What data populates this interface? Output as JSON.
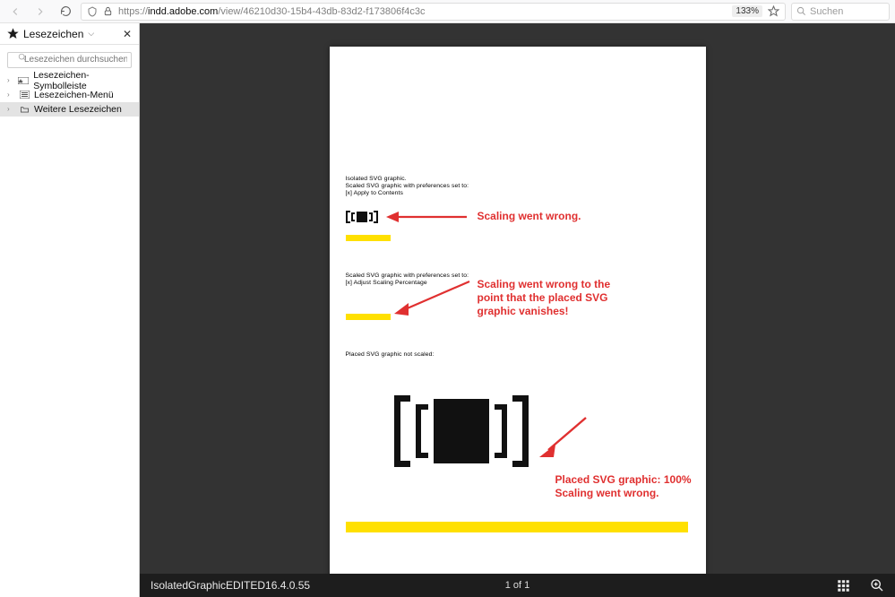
{
  "toolbar": {
    "url_prefix": "https://",
    "url_host": "indd.adobe.com",
    "url_path": "/view/46210d30-15b4-43db-83d2-f173806f4c3c",
    "zoom": "133%",
    "search_placeholder": "Suchen"
  },
  "sidebar": {
    "title": "Lesezeichen",
    "search_placeholder": "Lesezeichen durchsuchen",
    "items": [
      {
        "label": "Lesezeichen-Symbolleiste"
      },
      {
        "label": "Lesezeichen-Menü"
      },
      {
        "label": "Weitere Lesezeichen"
      }
    ]
  },
  "document": {
    "filename": "IsolatedGraphicEDITED16.4.0.55",
    "page_label": "1 of 1",
    "captions": {
      "c1a": "Isolated SVG graphic.",
      "c1b": "Scaled SVG graphic with preferences set to:",
      "c1c": "[x] Apply to Contents",
      "c2a": "Scaled SVG graphic with preferences set to:",
      "c2b": "[x] Adjust Scaling Percentage",
      "c3": "Placed SVG graphic not scaled:"
    },
    "annotations": {
      "a1": "Scaling went wrong.",
      "a2": "Scaling went wrong to the point that the placed SVG graphic vanishes!",
      "a3": "Placed SVG graphic: 100% Scaling went wrong."
    }
  }
}
